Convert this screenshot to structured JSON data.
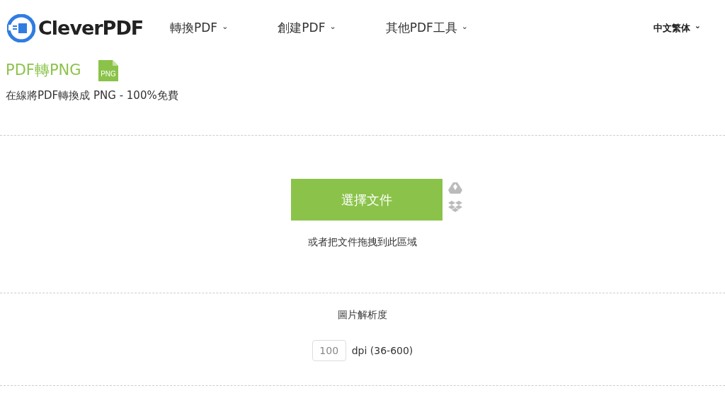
{
  "header": {
    "logo": "CleverPDF",
    "nav": [
      {
        "label": "轉換PDF",
        "caret": "⌄"
      },
      {
        "label": "創建PDF",
        "caret": "⌄"
      },
      {
        "label": "其他PDF工具",
        "caret": "⌄"
      }
    ],
    "language": {
      "label": "中文繁体",
      "caret": "⌄"
    }
  },
  "tool": {
    "title": "PDF轉PNG",
    "file_badge": "PNG",
    "subtitle": "在線將PDF轉換成 PNG - 100%免費"
  },
  "upload": {
    "button": "選擇文件",
    "hint": "或者把文件拖拽到此區域"
  },
  "options": {
    "label": "圖片解析度",
    "dpi": {
      "value": "100",
      "unit": "dpi (36-600)"
    }
  }
}
